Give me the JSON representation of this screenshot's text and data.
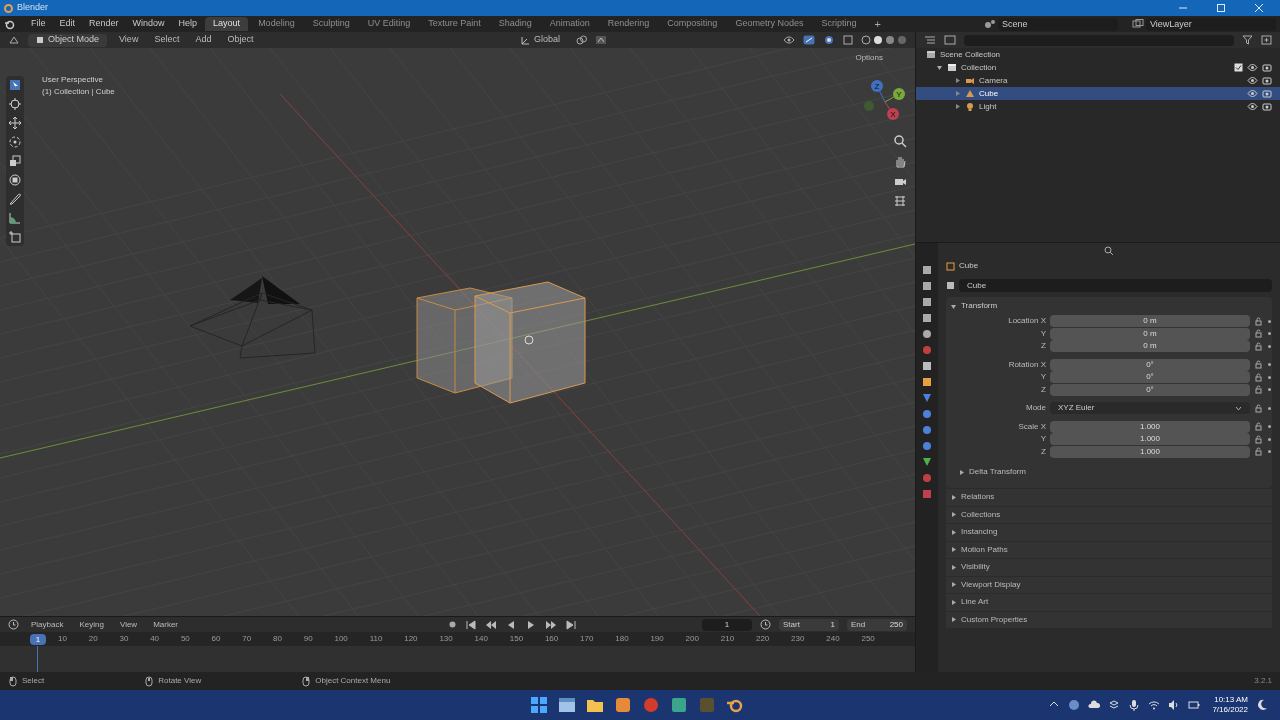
{
  "window": {
    "title": "Blender"
  },
  "menu": [
    "File",
    "Edit",
    "Render",
    "Window",
    "Help"
  ],
  "workspace_tabs": [
    {
      "label": "Layout",
      "selected": true
    },
    {
      "label": "Modeling",
      "selected": false
    },
    {
      "label": "Sculpting",
      "selected": false
    },
    {
      "label": "UV Editing",
      "selected": false
    },
    {
      "label": "Texture Paint",
      "selected": false
    },
    {
      "label": "Shading",
      "selected": false
    },
    {
      "label": "Animation",
      "selected": false
    },
    {
      "label": "Rendering",
      "selected": false
    },
    {
      "label": "Compositing",
      "selected": false
    },
    {
      "label": "Geometry Nodes",
      "selected": false
    },
    {
      "label": "Scripting",
      "selected": false
    }
  ],
  "add_tab": "+",
  "scene": "Scene",
  "view_layer": "ViewLayer",
  "viewport": {
    "mode": "Object Mode",
    "menus": [
      "View",
      "Select",
      "Add",
      "Object"
    ],
    "orientation": "Global",
    "options": "Options",
    "overlay_lines": [
      "User Perspective",
      "(1) Collection | Cube"
    ],
    "gizmo_axes": [
      "X",
      "Y",
      "Z"
    ]
  },
  "outliner": {
    "root": "Scene Collection",
    "items": [
      {
        "label": "Collection",
        "kind": "collection",
        "selected": false,
        "expanded": true,
        "children": [
          {
            "label": "Camera",
            "kind": "camera",
            "selected": false
          },
          {
            "label": "Cube",
            "kind": "mesh",
            "selected": true
          },
          {
            "label": "Light",
            "kind": "light",
            "selected": false
          }
        ]
      }
    ]
  },
  "properties": {
    "object_name": "Cube",
    "data_name": "Cube",
    "panel": "Transform",
    "expanded": true,
    "rows": [
      {
        "label": "Location X",
        "value": "0 m",
        "kind": "number"
      },
      {
        "label": "Y",
        "value": "0 m",
        "kind": "number"
      },
      {
        "label": "Z",
        "value": "0 m",
        "kind": "number"
      },
      {
        "label": "Rotation X",
        "value": "0°",
        "kind": "number"
      },
      {
        "label": "Y",
        "value": "0°",
        "kind": "number"
      },
      {
        "label": "Z",
        "value": "0°",
        "kind": "number"
      },
      {
        "label": "Mode",
        "value": "XYZ Euler",
        "kind": "dropdown"
      },
      {
        "label": "Scale X",
        "value": "1.000",
        "kind": "number"
      },
      {
        "label": "Y",
        "value": "1.000",
        "kind": "number"
      },
      {
        "label": "Z",
        "value": "1.000",
        "kind": "number"
      }
    ],
    "subpanel": "Delta Transform",
    "sections": [
      "Relations",
      "Collections",
      "Instancing",
      "Motion Paths",
      "Visibility",
      "Viewport Display",
      "Line Art",
      "Custom Properties"
    ]
  },
  "timeline": {
    "menus": [
      "Playback",
      "Keying",
      "View",
      "Marker"
    ],
    "current_frame": "1",
    "playhead_frame": "1",
    "start_label": "Start",
    "start_value": "1",
    "end_label": "End",
    "end_value": "250",
    "ruler": [
      "10",
      "20",
      "30",
      "40",
      "50",
      "60",
      "70",
      "80",
      "90",
      "100",
      "110",
      "120",
      "130",
      "140",
      "150",
      "160",
      "170",
      "180",
      "190",
      "200",
      "210",
      "220",
      "230",
      "240",
      "250"
    ]
  },
  "status_bar": {
    "hints": [
      "Select",
      "Rotate View",
      "Object Context Menu"
    ],
    "version": "3.2.1"
  },
  "taskbar": {
    "time": "10:13 AM",
    "date": "7/16/2022"
  }
}
